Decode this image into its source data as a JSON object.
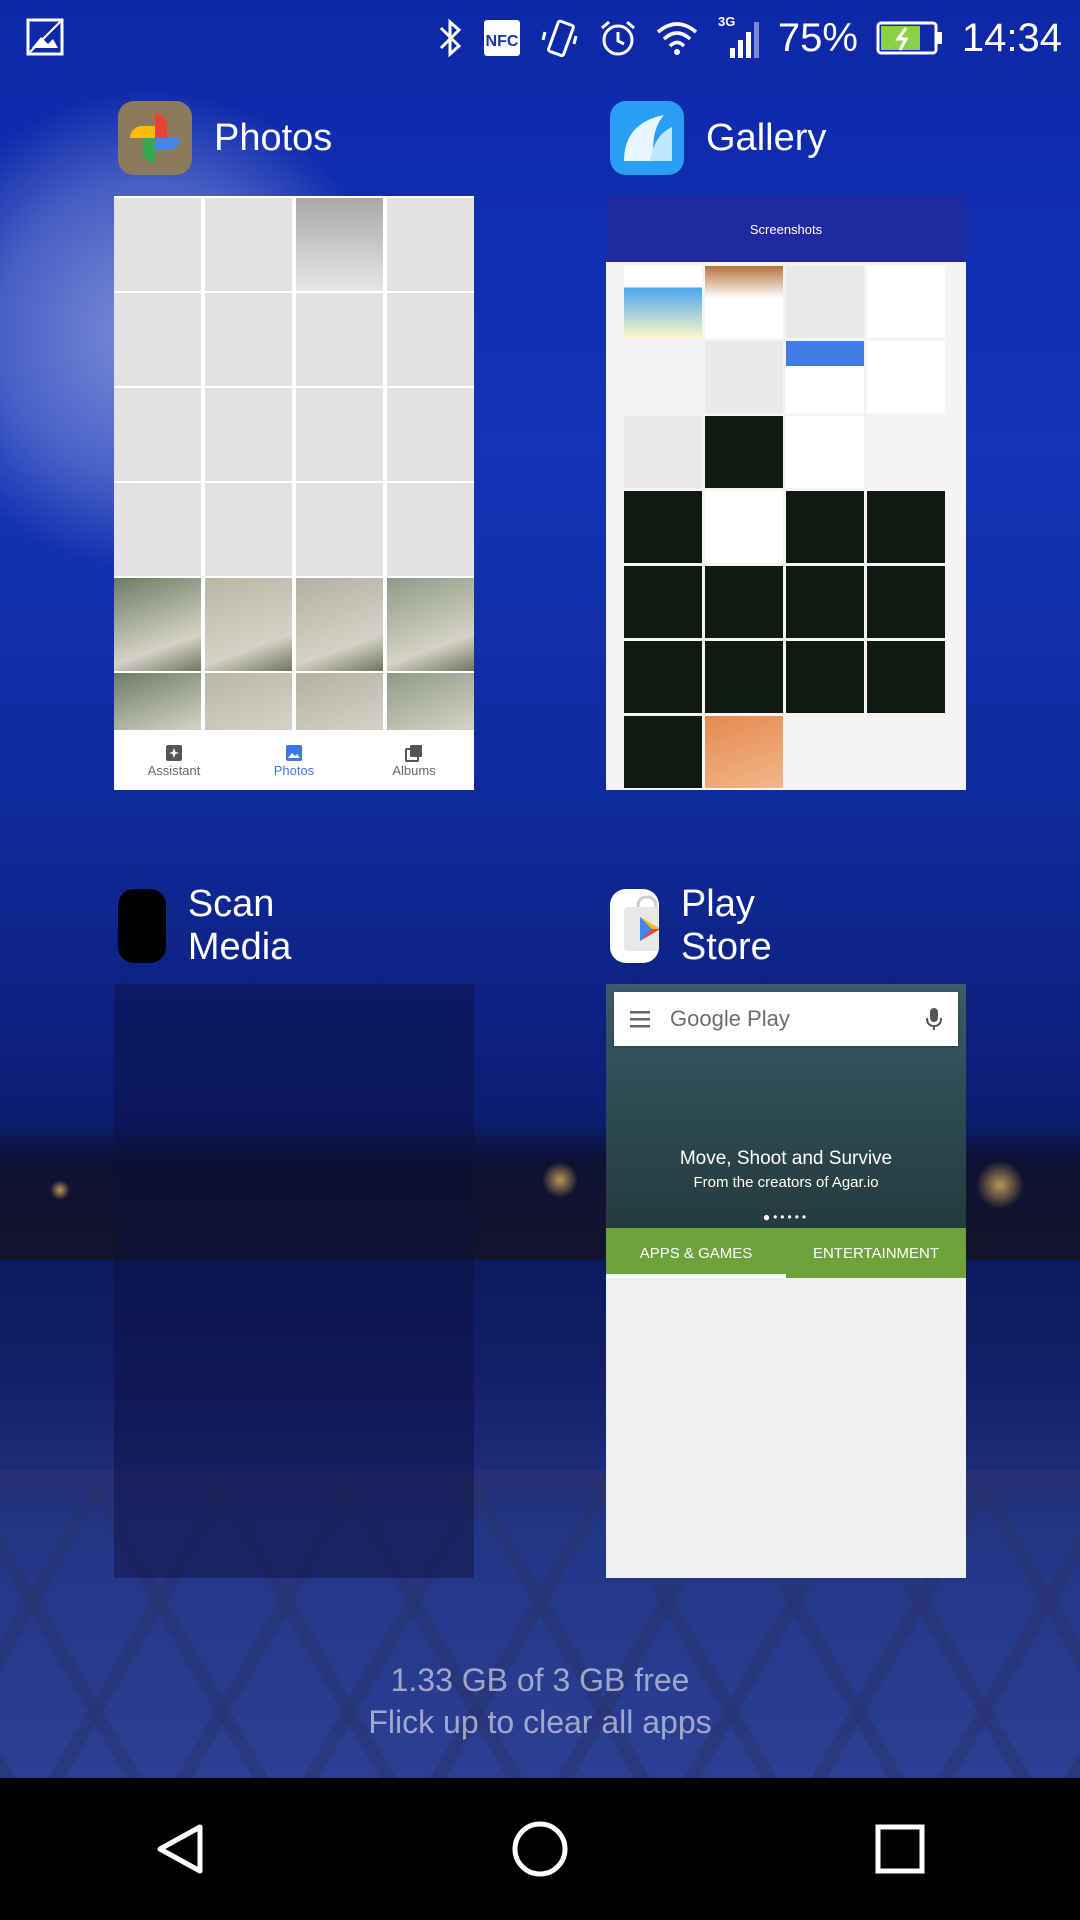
{
  "status_bar": {
    "network_type": "3G",
    "nfc_label": "NFC",
    "battery_percent": "75%",
    "battery_level": 0.75,
    "time": "14:34",
    "icons": [
      "gallery-notification-icon",
      "bluetooth-icon",
      "nfc-icon",
      "vibrate-icon",
      "alarm-icon",
      "wifi-icon",
      "signal-icon",
      "battery-icon"
    ]
  },
  "cards": [
    {
      "app": "Photos"
    },
    {
      "app": "Gallery",
      "screen_title": "Screenshots"
    },
    {
      "app": "Scan Media"
    },
    {
      "app": "Play Store",
      "search_placeholder": "Google Play",
      "banner_title": "Move, Shoot and Survive",
      "banner_subtitle": "From the creators of Agar.io",
      "tabs": [
        "APPS & GAMES",
        "ENTERTAINMENT"
      ]
    }
  ],
  "photos_nav": [
    "Assistant",
    "Photos",
    "Albums"
  ],
  "footer": {
    "memory": "1.33 GB of 3 GB free",
    "hint": "Flick up to clear all apps"
  },
  "colors": {
    "photos_active": "#3b78e7",
    "play_green": "#6ea33b",
    "gallery_header": "#1f2aa0",
    "navbar": "#000000"
  }
}
